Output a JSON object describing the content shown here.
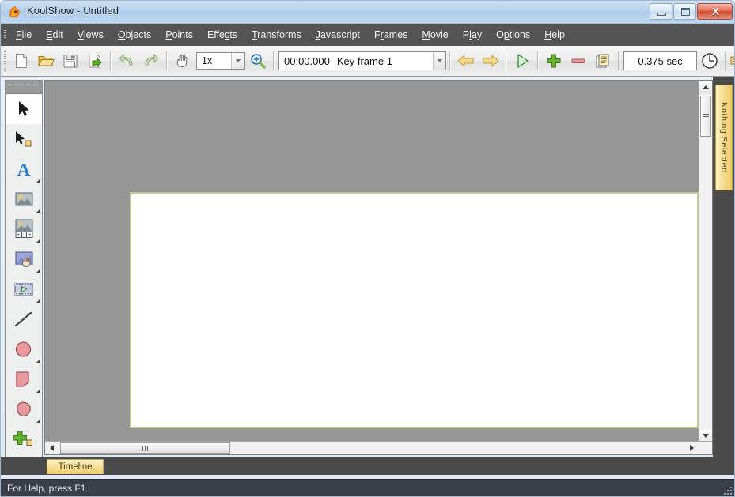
{
  "window": {
    "title": "KoolShow - Untitled",
    "app_icon": "fox-logo-icon",
    "minimize_label": "Minimize",
    "maximize_label": "Maximize",
    "close_label": "X"
  },
  "menubar": {
    "items": [
      {
        "label": "File",
        "mnemonic": "F",
        "name": "menu-file"
      },
      {
        "label": "Edit",
        "mnemonic": "E",
        "name": "menu-edit"
      },
      {
        "label": "Views",
        "mnemonic": "V",
        "name": "menu-views"
      },
      {
        "label": "Objects",
        "mnemonic": "O",
        "name": "menu-objects"
      },
      {
        "label": "Points",
        "mnemonic": "P",
        "name": "menu-points"
      },
      {
        "label": "Effects",
        "mnemonic": "c",
        "name": "menu-effects"
      },
      {
        "label": "Transforms",
        "mnemonic": "T",
        "name": "menu-transforms"
      },
      {
        "label": "Javascript",
        "mnemonic": "J",
        "name": "menu-javascript"
      },
      {
        "label": "Frames",
        "mnemonic": "r",
        "name": "menu-frames"
      },
      {
        "label": "Movie",
        "mnemonic": "M",
        "name": "menu-movie"
      },
      {
        "label": "Play",
        "mnemonic": "l",
        "name": "menu-play"
      },
      {
        "label": "Options",
        "mnemonic": "p",
        "name": "menu-options"
      },
      {
        "label": "Help",
        "mnemonic": "H",
        "name": "menu-help"
      }
    ]
  },
  "toolbar": {
    "new_label": "New",
    "open_label": "Open",
    "save_label": "Save",
    "export_label": "Export",
    "undo_label": "Undo",
    "redo_label": "Redo",
    "pan_label": "Pan",
    "zoom_value": "1x",
    "zoom_tool_label": "Zoom",
    "keyframe_time": "00:00.000",
    "keyframe_label": "Key frame 1",
    "prev_frame_label": "Previous frame",
    "next_frame_label": "Next frame",
    "play_label": "Play",
    "add_frame_label": "Add frame",
    "remove_frame_label": "Remove frame",
    "frames_label": "Frames",
    "duration_value": "0.375 sec",
    "clock_label": "Timing",
    "overflow_label": "More"
  },
  "tools": [
    {
      "name": "tool-select",
      "label": "Select",
      "selected": true,
      "has_flyout": false
    },
    {
      "name": "tool-select-point",
      "label": "Select point",
      "selected": false,
      "has_flyout": false
    },
    {
      "name": "tool-text",
      "label": "Text",
      "selected": false,
      "has_flyout": true
    },
    {
      "name": "tool-image",
      "label": "Image",
      "selected": false,
      "has_flyout": true
    },
    {
      "name": "tool-animated-image",
      "label": "Animated image",
      "selected": false,
      "has_flyout": true
    },
    {
      "name": "tool-image-button",
      "label": "Image button",
      "selected": false,
      "has_flyout": true
    },
    {
      "name": "tool-video",
      "label": "Video",
      "selected": false,
      "has_flyout": true
    },
    {
      "name": "tool-line",
      "label": "Line",
      "selected": false,
      "has_flyout": false
    },
    {
      "name": "tool-ellipse",
      "label": "Ellipse",
      "selected": false,
      "has_flyout": true
    },
    {
      "name": "tool-polygon",
      "label": "Polygon",
      "selected": false,
      "has_flyout": true
    },
    {
      "name": "tool-freeform",
      "label": "Freeform shape",
      "selected": false,
      "has_flyout": true
    },
    {
      "name": "tool-add-object",
      "label": "Add object",
      "selected": false,
      "has_flyout": false
    }
  ],
  "canvas": {
    "stage_background": "#ffffff",
    "stage_border_color": "#c9c893",
    "workspace_color": "#969696"
  },
  "panels": {
    "selection_tab": "Nothing Selected",
    "timeline_tab": "Timeline"
  },
  "statusbar": {
    "message": "For Help, press F1"
  },
  "colors": {
    "titlebar": "#b9d2ec",
    "menubar": "#545454",
    "toolbar": "#ededed",
    "workspace": "#969696",
    "accent_tab": "#f6dd92",
    "statusbar": "#3a3f4a"
  }
}
